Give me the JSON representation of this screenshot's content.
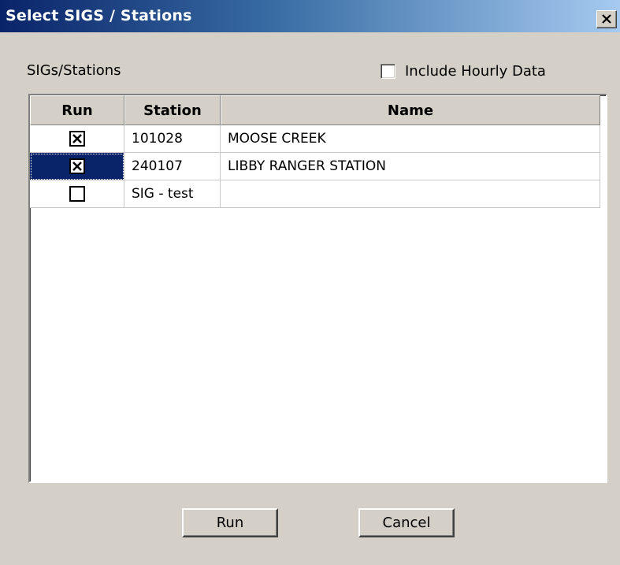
{
  "window": {
    "title": "Select SIGS / Stations",
    "close_icon": "close-icon"
  },
  "section_label": "SIGs/Stations",
  "include_hourly": {
    "label": "Include Hourly Data",
    "checked": false
  },
  "grid": {
    "columns": [
      "Run",
      "Station",
      "Name"
    ],
    "rows": [
      {
        "run": true,
        "station": "101028",
        "name": "MOOSE CREEK",
        "selected": false
      },
      {
        "run": true,
        "station": "240107",
        "name": "LIBBY RANGER STATION",
        "selected": true
      },
      {
        "run": false,
        "station": "SIG - test",
        "name": "",
        "selected": false
      }
    ]
  },
  "buttons": {
    "run": "Run",
    "cancel": "Cancel"
  },
  "colors": {
    "title_start": "#0a246a",
    "title_end": "#a6caf0",
    "selection": "#0a246a",
    "face": "#d4d0c8"
  }
}
